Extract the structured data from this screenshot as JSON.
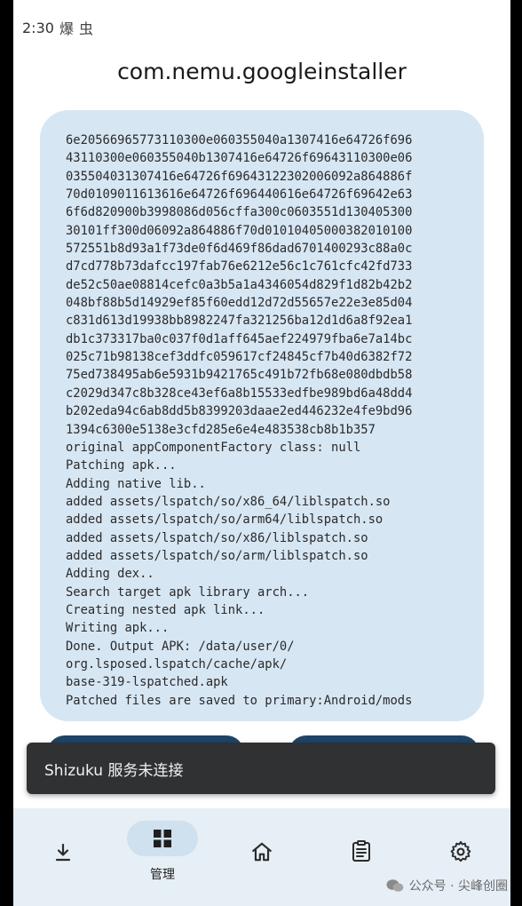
{
  "status_bar": {
    "time": "2:30",
    "icon1": "爆",
    "icon2": "虫"
  },
  "app": {
    "title": "com.nemu.googleinstaller"
  },
  "log": {
    "lines": [
      "6e20566965773110300e060355040a1307416e64726f696",
      "43110300e060355040b1307416e64726f69643110300e06",
      "035504031307416e64726f69643122302006092a864886f",
      "70d0109011613616e64726f696440616e64726f69642e63",
      "6f6d820900b3998086d056cffa300c0603551d130405300",
      "30101ff300d06092a864886f70d01010405000382010100",
      "572551b8d93a1f73de0f6d469f86dad6701400293c88a0c",
      "d7cd778b73dafcc197fab76e6212e56c1c761cfc42fd733",
      "de52c50ae08814cefc0a3b5a1a4346054d829f1d82b42b2",
      "048bf88b5d14929ef85f60edd12d72d55657e22e3e85d04",
      "c831d613d19938bb8982247fa321256ba12d1d6a8f92ea1",
      "db1c373317ba0c037f0d1aff645aef224979fba6e7a14bc",
      "025c71b98138cef3ddfc059617cf24845cf7b40d6382f72",
      "75ed738495ab6e5931b9421765c491b72fb68e080dbdb58",
      "c2029d347c8b328ce43ef6a8b15533edfbe989bd6a48dd4",
      "b202eda94c6ab8dd5b8399203daae2ed446232e4fe9bd96",
      "1394c6300e5138e3cfd285e6e4e483538cb8b1b357",
      "original appComponentFactory class: null",
      "Patching apk...",
      "Adding native lib..",
      "added assets/lspatch/so/x86_64/liblspatch.so",
      "added assets/lspatch/so/arm64/liblspatch.so",
      "added assets/lspatch/so/x86/liblspatch.so",
      "added assets/lspatch/so/arm/liblspatch.so",
      "Adding dex..",
      "Search target apk library arch...",
      "Creating nested apk link...",
      "Writing apk...",
      "Done. Output APK: /data/user/0/",
      "org.lsposed.lspatch/cache/apk/",
      "base-319-lspatched.apk",
      "Patched files are saved to primary:Android/mods"
    ]
  },
  "snackbar": {
    "message": "Shizuku 服务未连接"
  },
  "bottom_nav": {
    "items": [
      {
        "icon": "download-icon",
        "label": ""
      },
      {
        "icon": "grid-icon",
        "label": "管理",
        "active": true
      },
      {
        "icon": "home-icon",
        "label": ""
      },
      {
        "icon": "clipboard-icon",
        "label": ""
      },
      {
        "icon": "settings-icon",
        "label": ""
      }
    ]
  },
  "watermark": {
    "text": "公众号 · 尖峰创圈"
  },
  "colors": {
    "card_bg": "#d7e6f3",
    "nav_bg": "#e6eff6",
    "snackbar_bg": "#2f3133",
    "pill_accent": "#1e4466"
  }
}
